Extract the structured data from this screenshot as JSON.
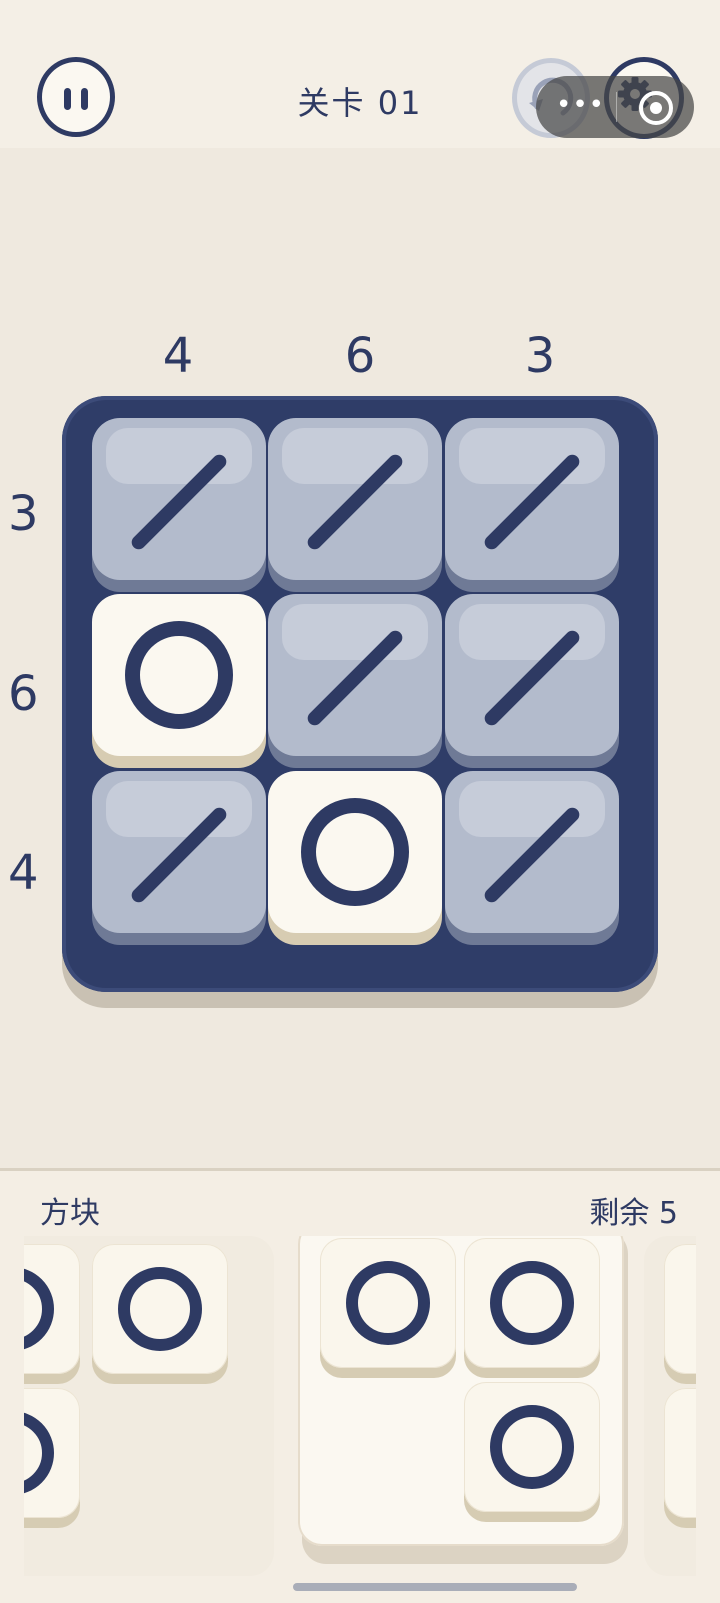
{
  "header": {
    "level_title": "关卡 01"
  },
  "icons": {
    "pause": "pause-icon",
    "undo": "undo-icon",
    "settings": "gear-icon",
    "more": "more-icon",
    "close": "target-icon"
  },
  "capsule": {
    "dots": "•••"
  },
  "clues": {
    "columns": [
      "4",
      "6",
      "3"
    ],
    "rows": [
      "3",
      "6",
      "4"
    ]
  },
  "board": {
    "rows": [
      [
        "slash",
        "slash",
        "slash"
      ],
      [
        "circle",
        "slash",
        "slash"
      ],
      [
        "slash",
        "circle",
        "slash"
      ]
    ]
  },
  "tray": {
    "left_label": "方块",
    "right_label": "剩余 5"
  },
  "colors": {
    "navy": "#2e3a63",
    "board": "#2f3d68",
    "tile_gray": "#b3bbcc",
    "tile_cream": "#fbf8f0",
    "background": "#efe9df"
  }
}
